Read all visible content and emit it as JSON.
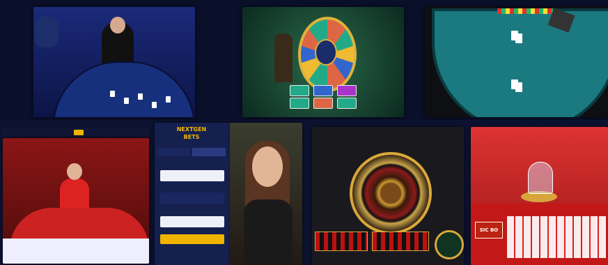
{
  "login": {
    "logo_line1": "NEXTGEN",
    "logo_line2": "BETS",
    "tab_login": "",
    "tab_register": "",
    "field1_value": "",
    "field2_value": "",
    "field3_value": "",
    "submit_label": ""
  },
  "sicbo": {
    "sign": "SIC BO"
  },
  "colors": {
    "accent": "#f0b400",
    "navy": "#0c1230",
    "table_red": "#c22",
    "table_teal": "#1a7a80"
  }
}
